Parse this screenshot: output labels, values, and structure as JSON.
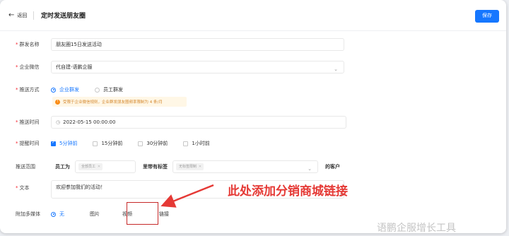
{
  "header": {
    "back_label": "返回",
    "title": "定时发送朋友圈",
    "save_label": "保存"
  },
  "form": {
    "name": {
      "label": "群发名称",
      "value": "朋友圈15日发送活动"
    },
    "wecom": {
      "label": "企业微信",
      "value": "代自建-语鹏企服"
    },
    "push_method": {
      "label": "推送方式",
      "options": [
        "企业群发",
        "员工群发"
      ],
      "selected": "企业群发",
      "notice": "受限于企业微信规则，企业群发朋友圈频率限制为 4 条/月"
    },
    "push_time": {
      "label": "推送时间",
      "value": "2022-05-15 00:00:00"
    },
    "remind_time": {
      "label": "提醒时间",
      "options": [
        "5分钟前",
        "15分钟前",
        "30分钟前",
        "1小时前"
      ],
      "selected": "5分钟前"
    },
    "scope": {
      "label": "推送范围",
      "staff_label": "员工为",
      "staff_tag": "全部员工",
      "tags_label": "里带有标签",
      "tags_tag": "无标签限制",
      "customer_suffix": "的客户"
    },
    "text": {
      "label": "文本",
      "value": "欢迎参加我们的活动！"
    },
    "media": {
      "label": "附加多媒体",
      "options": [
        "无",
        "图片",
        "视频",
        "链接"
      ],
      "selected": "无"
    }
  },
  "annotation": {
    "text": "此处添加分销商城链接",
    "color": "#e53935"
  },
  "watermark": "语鹏企服增长工具",
  "colors": {
    "primary": "#1677ff",
    "required": "#f5222d",
    "notice_bg": "#fff7e6",
    "notice_text": "#d4862a"
  }
}
